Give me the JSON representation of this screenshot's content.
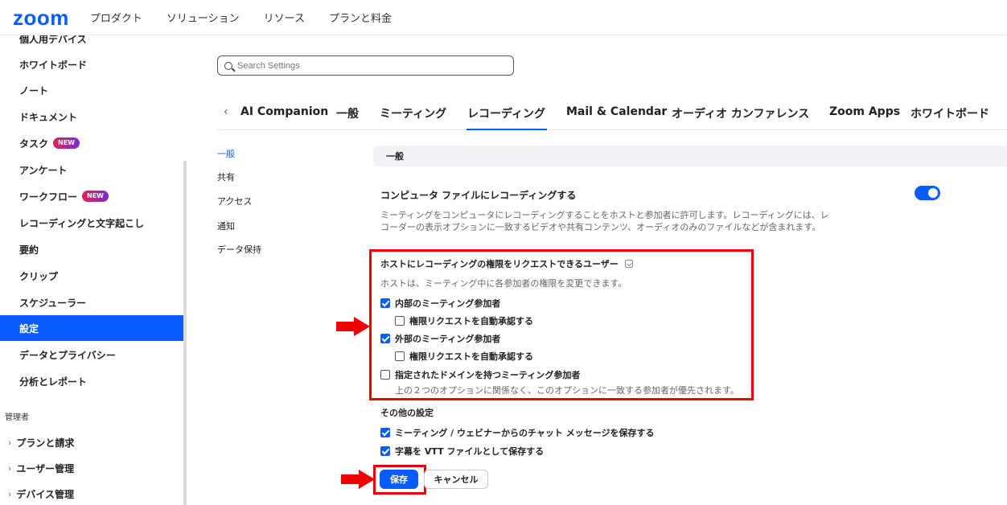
{
  "header": {
    "logo": "zoom",
    "nav": [
      "プロダクト",
      "ソリューション",
      "リソース",
      "プランと料金"
    ]
  },
  "sidebar": {
    "items": [
      {
        "label": "個人用デバイス"
      },
      {
        "label": "ホワイトボード"
      },
      {
        "label": "ノート"
      },
      {
        "label": "ドキュメント"
      },
      {
        "label": "タスク",
        "badge": "NEW"
      },
      {
        "label": "アンケート"
      },
      {
        "label": "ワークフロー",
        "badge": "NEW"
      },
      {
        "label": "レコーディングと文字起こし"
      },
      {
        "label": "要約"
      },
      {
        "label": "クリップ"
      },
      {
        "label": "スケジューラー"
      },
      {
        "label": "設定",
        "active": true
      },
      {
        "label": "データとプライバシー"
      },
      {
        "label": "分析とレポート"
      }
    ],
    "admin_section": "管理者",
    "admin_items": [
      {
        "label": "プランと請求"
      },
      {
        "label": "ユーザー管理"
      },
      {
        "label": "デバイス管理"
      }
    ]
  },
  "search": {
    "placeholder": "Search Settings"
  },
  "tabs": [
    "AI Companion",
    "一般",
    "ミーティング",
    "レコーディング",
    "Mail & Calendar",
    "オーディオ カンファレンス",
    "Zoom Apps",
    "ホワイトボード"
  ],
  "active_tab": "レコーディング",
  "subnav": [
    "一般",
    "共有",
    "アクセス",
    "通知",
    "データ保持"
  ],
  "section_title": "一般",
  "setting": {
    "title": "コンピュータ ファイルにレコーディングする",
    "description": "ミーティングをコンピュータにレコーディングすることをホストと参加者に許可します。レコーディングには、レコーダーの表示オプションに一致するビデオや共有コンテンツ、オーディオのみのファイルなどが含まれます。",
    "enabled": true
  },
  "permission": {
    "title": "ホストにレコーディングの権限をリクエストできるユーザー",
    "description": "ホストは、ミーティング中に各参加者の権限を変更できます。",
    "options": [
      {
        "label": "内部のミーティング参加者",
        "checked": true
      },
      {
        "label": "権限リクエストを自動承認する",
        "checked": false
      },
      {
        "label": "外部のミーティング参加者",
        "checked": true
      },
      {
        "label": "権限リクエストを自動承認する",
        "checked": false
      },
      {
        "label": "指定されたドメインを持つミーティング参加者",
        "checked": false
      }
    ],
    "note": "上の２つのオプションに関係なく、このオプションに一致する参加者が優先されます。"
  },
  "other": {
    "title": "その他の設定",
    "options": [
      {
        "label": "ミーティング / ウェビナーからのチャット メッセージを保存する",
        "checked": true
      },
      {
        "label": "字幕を VTT ファイルとして保存する",
        "checked": true
      }
    ]
  },
  "buttons": {
    "save": "保存",
    "cancel": "キャンセル"
  },
  "colors": {
    "accent": "#0b5cff",
    "highlight": "#ee0000"
  }
}
